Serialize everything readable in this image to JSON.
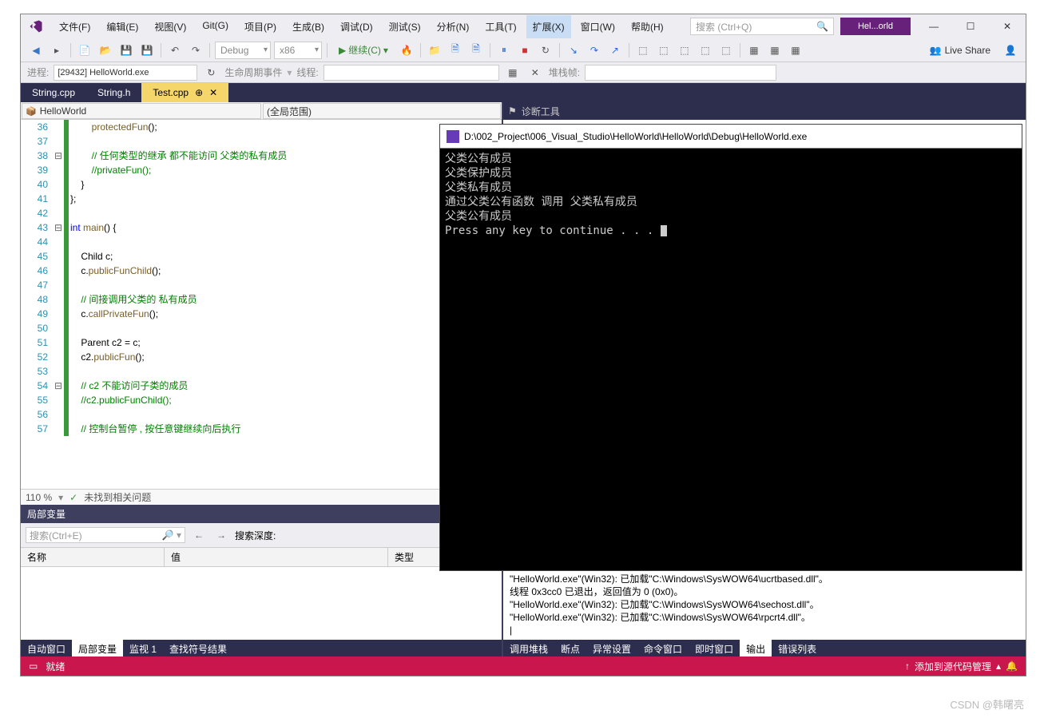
{
  "menu": {
    "items": [
      "文件(F)",
      "编辑(E)",
      "视图(V)",
      "Git(G)",
      "项目(P)",
      "生成(B)",
      "调试(D)",
      "测试(S)",
      "分析(N)",
      "工具(T)",
      "扩展(X)",
      "窗口(W)",
      "帮助(H)"
    ]
  },
  "search": {
    "placeholder": "搜索 (Ctrl+Q)"
  },
  "solution_badge": "Hel...orld",
  "toolbar": {
    "config": "Debug",
    "platform": "x86",
    "run": "继续(C)"
  },
  "toolbar2": {
    "proc_label": "进程:",
    "proc": "[29432] HelloWorld.exe",
    "life": "生命周期事件",
    "thread_label": "线程:",
    "stack": "堆栈帧:"
  },
  "tabs": [
    {
      "label": "String.cpp"
    },
    {
      "label": "String.h"
    },
    {
      "label": "Test.cpp",
      "active": true
    }
  ],
  "nav": {
    "left": "HelloWorld",
    "right": "(全局范围)"
  },
  "code": {
    "start": 36,
    "lines": [
      {
        "n": 36,
        "txt": "        protectedFun();",
        "seg": [
          {
            "t": "        "
          },
          {
            "t": "protectedFun",
            "c": "fn"
          },
          {
            "t": "();"
          }
        ]
      },
      {
        "n": 37,
        "txt": ""
      },
      {
        "n": 38,
        "txt": "        // 任何类型的继承 都不能访问 父类的私有成员",
        "seg": [
          {
            "t": "        "
          },
          {
            "t": "// 任何类型的继承 都不能访问 父类的私有成员",
            "c": "cm"
          }
        ]
      },
      {
        "n": 39,
        "txt": "        //privateFun();",
        "seg": [
          {
            "t": "        "
          },
          {
            "t": "//privateFun();",
            "c": "cm"
          }
        ]
      },
      {
        "n": 40,
        "txt": "    }"
      },
      {
        "n": 41,
        "txt": "};"
      },
      {
        "n": 42,
        "txt": ""
      },
      {
        "n": 43,
        "txt": "int main() {",
        "seg": [
          {
            "t": "int ",
            "c": "kw"
          },
          {
            "t": "main",
            "c": "fn"
          },
          {
            "t": "() {"
          }
        ],
        "fold": "⊟"
      },
      {
        "n": 44,
        "txt": ""
      },
      {
        "n": 45,
        "txt": "    Child c;",
        "seg": [
          {
            "t": "    Child c;"
          }
        ]
      },
      {
        "n": 46,
        "txt": "    c.publicFunChild();",
        "seg": [
          {
            "t": "    c."
          },
          {
            "t": "publicFunChild",
            "c": "fn"
          },
          {
            "t": "();"
          }
        ]
      },
      {
        "n": 47,
        "txt": ""
      },
      {
        "n": 48,
        "txt": "    // 间接调用父类的 私有成员",
        "seg": [
          {
            "t": "    "
          },
          {
            "t": "// 间接调用父类的 私有成员",
            "c": "cm"
          }
        ]
      },
      {
        "n": 49,
        "txt": "    c.callPrivateFun();",
        "seg": [
          {
            "t": "    c."
          },
          {
            "t": "callPrivateFun",
            "c": "fn"
          },
          {
            "t": "();"
          }
        ]
      },
      {
        "n": 50,
        "txt": ""
      },
      {
        "n": 51,
        "txt": "    Parent c2 = c;",
        "seg": [
          {
            "t": "    Parent c2 = c;"
          }
        ]
      },
      {
        "n": 52,
        "txt": "    c2.publicFun();",
        "seg": [
          {
            "t": "    c2."
          },
          {
            "t": "publicFun",
            "c": "fn"
          },
          {
            "t": "();"
          }
        ]
      },
      {
        "n": 53,
        "txt": ""
      },
      {
        "n": 54,
        "txt": "    // c2 不能访问子类的成员",
        "seg": [
          {
            "t": "    "
          },
          {
            "t": "// c2 不能访问子类的成员",
            "c": "cm"
          }
        ]
      },
      {
        "n": 55,
        "txt": "    //c2.publicFunChild();",
        "seg": [
          {
            "t": "    "
          },
          {
            "t": "//c2.publicFunChild();",
            "c": "cm"
          }
        ]
      },
      {
        "n": 56,
        "txt": ""
      },
      {
        "n": 57,
        "txt": "    // 控制台暂停 , 按任意键继续向后执行",
        "seg": [
          {
            "t": "    "
          },
          {
            "t": "// 控制台暂停 , 按任意键继续向后执行",
            "c": "cm"
          }
        ],
        "cut": true
      }
    ]
  },
  "ed_footer": {
    "zoom": "110 %",
    "issues": "未找到相关问题"
  },
  "locals": {
    "title": "局部变量",
    "search_ph": "搜索(Ctrl+E)",
    "depth_label": "搜索深度:",
    "cols": [
      "名称",
      "值",
      "类型"
    ]
  },
  "bottom_left_tabs": [
    "自动窗口",
    "局部变量",
    "监视 1",
    "查找符号结果"
  ],
  "right_panel": {
    "title": "诊断工具"
  },
  "output": {
    "lines": [
      "\"HelloWorld.exe\"(Win32): 已加载\"C:\\Windows\\SysWOW64\\ucrtbased.dll\"。",
      "线程 0x3cc0 已退出，返回值为 0 (0x0)。",
      "\"HelloWorld.exe\"(Win32): 已加载\"C:\\Windows\\SysWOW64\\sechost.dll\"。",
      "\"HelloWorld.exe\"(Win32): 已加载\"C:\\Windows\\SysWOW64\\rpcrt4.dll\"。"
    ]
  },
  "bottom_right_tabs": [
    "调用堆栈",
    "断点",
    "异常设置",
    "命令窗口",
    "即时窗口",
    "输出",
    "错误列表"
  ],
  "status": {
    "ready": "就绪",
    "add_src": "添加到源代码管理"
  },
  "liveshare": "Live Share",
  "console": {
    "title": "D:\\002_Project\\006_Visual_Studio\\HelloWorld\\HelloWorld\\Debug\\HelloWorld.exe",
    "lines": [
      "父类公有成员",
      "父类保护成员",
      "父类私有成员",
      "通过父类公有函数 调用 父类私有成员",
      "父类公有成员",
      "Press any key to continue . . . "
    ]
  },
  "watermark": "CSDN @韩曙亮"
}
